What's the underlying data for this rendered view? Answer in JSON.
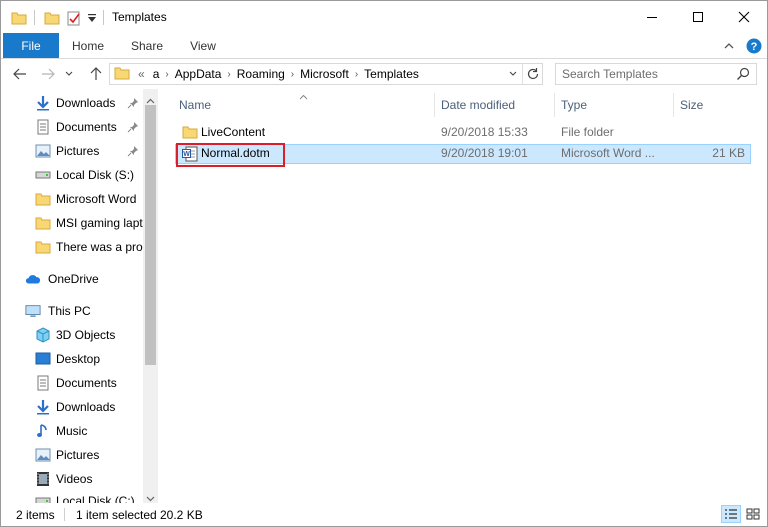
{
  "window": {
    "title": "Templates"
  },
  "ribbon": {
    "tabs": [
      "File",
      "Home",
      "Share",
      "View"
    ]
  },
  "address": {
    "overflow": "«",
    "crumbs": [
      "a",
      "AppData",
      "Roaming",
      "Microsoft",
      "Templates"
    ]
  },
  "search": {
    "placeholder": "Search Templates"
  },
  "nav": {
    "quick_access": [
      {
        "label": "Downloads",
        "icon": "download-arrow-icon",
        "pinned": true
      },
      {
        "label": "Documents",
        "icon": "documents-icon",
        "pinned": true
      },
      {
        "label": "Pictures",
        "icon": "pictures-icon",
        "pinned": true
      },
      {
        "label": "Local Disk (S:)",
        "icon": "drive-icon",
        "pinned": false
      },
      {
        "label": "Microsoft Word",
        "icon": "folder-icon",
        "pinned": false
      },
      {
        "label": "MSI gaming lapt",
        "icon": "folder-icon",
        "pinned": false
      },
      {
        "label": "There was a prob",
        "icon": "folder-icon",
        "pinned": false
      }
    ],
    "onedrive": "OneDrive",
    "this_pc": "This PC",
    "pc_items": [
      {
        "label": "3D Objects",
        "icon": "3d-objects-icon"
      },
      {
        "label": "Desktop",
        "icon": "desktop-icon"
      },
      {
        "label": "Documents",
        "icon": "documents-icon"
      },
      {
        "label": "Downloads",
        "icon": "download-arrow-icon"
      },
      {
        "label": "Music",
        "icon": "music-icon"
      },
      {
        "label": "Pictures",
        "icon": "pictures-icon"
      },
      {
        "label": "Videos",
        "icon": "videos-icon"
      },
      {
        "label": "Local Disk (C:)",
        "icon": "drive-icon"
      }
    ]
  },
  "columns": {
    "name": "Name",
    "date": "Date modified",
    "type": "Type",
    "size": "Size"
  },
  "files": [
    {
      "name": "LiveContent",
      "date": "9/20/2018 15:33",
      "type": "File folder",
      "size": "",
      "icon": "folder-icon",
      "selected": false
    },
    {
      "name": "Normal.dotm",
      "date": "9/20/2018 19:01",
      "type": "Microsoft Word ...",
      "size": "21 KB",
      "icon": "word-template-icon",
      "selected": true
    }
  ],
  "status": {
    "count": "2 items",
    "selection": "1 item selected",
    "size": "20.2 KB"
  },
  "colors": {
    "accent": "#1979ca",
    "selection": "#cce8ff",
    "highlight": "#d9202a",
    "folder": "#f8d775"
  }
}
